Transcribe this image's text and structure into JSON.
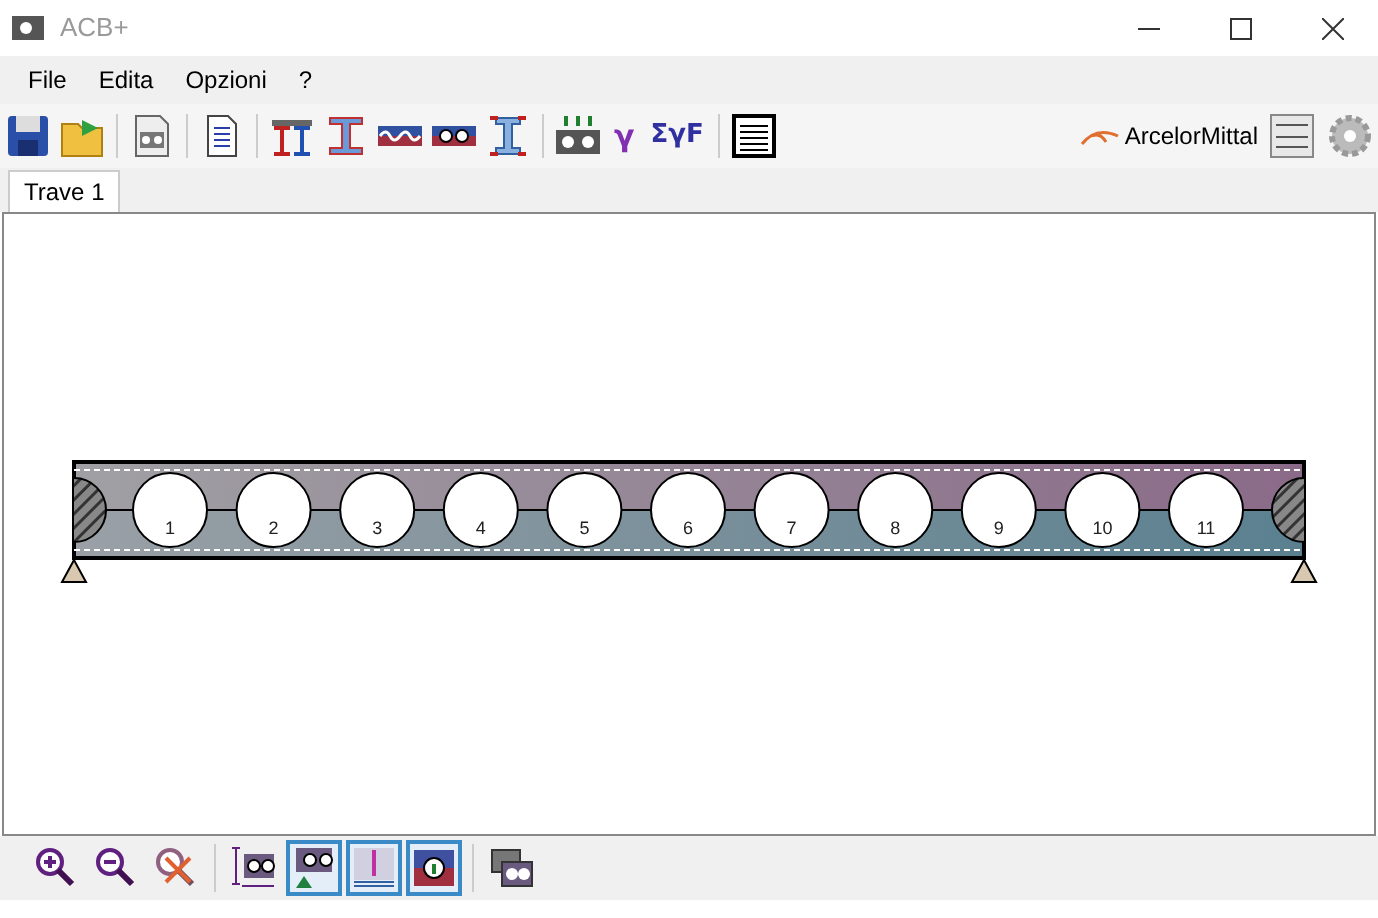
{
  "window": {
    "title": "ACB+"
  },
  "menu": [
    "File",
    "Edita",
    "Opzioni",
    "?"
  ],
  "toolbar": [
    {
      "kind": "save"
    },
    {
      "kind": "open"
    },
    {
      "kind": "sep"
    },
    {
      "kind": "beam-doc"
    },
    {
      "kind": "sep"
    },
    {
      "kind": "report"
    },
    {
      "kind": "sep"
    },
    {
      "kind": "profiles"
    },
    {
      "kind": "profile"
    },
    {
      "kind": "wave"
    },
    {
      "kind": "holes"
    },
    {
      "kind": "height"
    },
    {
      "kind": "sep"
    },
    {
      "kind": "loads"
    },
    {
      "kind": "gamma",
      "label": "γ"
    },
    {
      "kind": "sum",
      "label": "ΣγF"
    },
    {
      "kind": "sep"
    },
    {
      "kind": "list"
    }
  ],
  "brand": "ArcelorMittal",
  "tabs": [
    {
      "label": "Trave 1",
      "selected": true
    }
  ],
  "beam": {
    "openings": [
      "1",
      "2",
      "3",
      "4",
      "5",
      "6",
      "7",
      "8",
      "9",
      "10",
      "11"
    ]
  },
  "bottom_toolbar": [
    {
      "kind": "zoom-in",
      "selected": false
    },
    {
      "kind": "zoom-out",
      "selected": false
    },
    {
      "kind": "zoom-reset",
      "selected": false
    },
    {
      "kind": "sep"
    },
    {
      "kind": "dims",
      "selected": false
    },
    {
      "kind": "support",
      "selected": true
    },
    {
      "kind": "stiffener",
      "selected": true
    },
    {
      "kind": "info",
      "selected": true
    },
    {
      "kind": "sep"
    },
    {
      "kind": "copy",
      "selected": false
    }
  ]
}
